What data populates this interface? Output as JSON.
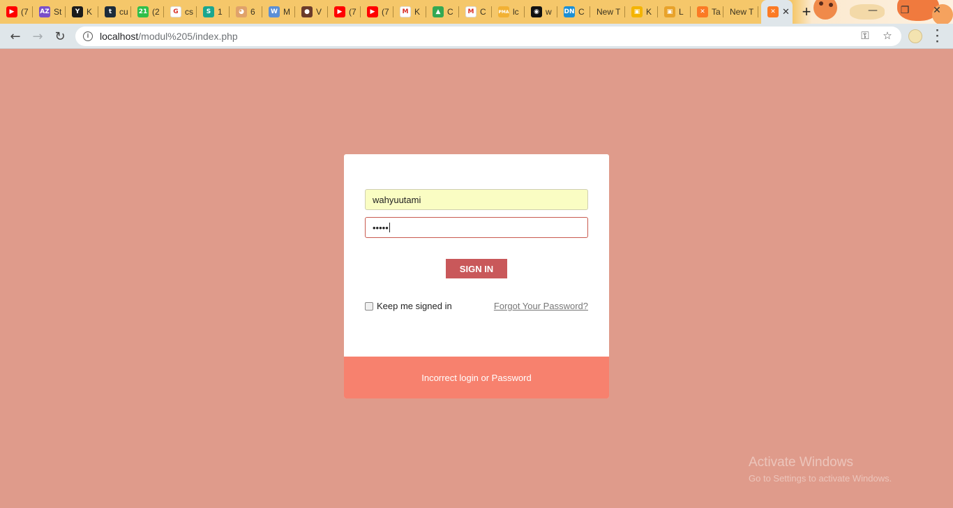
{
  "browser": {
    "tabs": [
      {
        "icon": "youtube-icon",
        "title": "(7",
        "color": "#ff0000",
        "glyph": "▶"
      },
      {
        "icon": "az-icon",
        "title": "St",
        "color": "#7a4fc9",
        "glyph": "AZ"
      },
      {
        "icon": "y-icon",
        "title": "K",
        "color": "#1b1b1b",
        "glyph": "Y"
      },
      {
        "icon": "tumblr-icon",
        "title": "cu",
        "color": "#1d2b3a",
        "glyph": "t"
      },
      {
        "icon": "badge-21-icon",
        "title": "(2",
        "color": "#2fbf4a",
        "glyph": "21"
      },
      {
        "icon": "google-icon",
        "title": "cs",
        "color": "#ffffff",
        "glyph": "G"
      },
      {
        "icon": "s-icon",
        "title": "1",
        "color": "#1aa68f",
        "glyph": "S"
      },
      {
        "icon": "cartoon-icon",
        "title": "6",
        "color": "#e0a26a",
        "glyph": "◕"
      },
      {
        "icon": "wordpress-icon",
        "title": "M",
        "color": "#5b8fd6",
        "glyph": "W"
      },
      {
        "icon": "avatar-photo-icon",
        "title": "V",
        "color": "#6b3b2a",
        "glyph": "●"
      },
      {
        "icon": "youtube-icon",
        "title": "(7",
        "color": "#ff0000",
        "glyph": "▶"
      },
      {
        "icon": "youtube-icon",
        "title": "(7",
        "color": "#ff0000",
        "glyph": "▶"
      },
      {
        "icon": "gmail-icon",
        "title": "K",
        "color": "#ffffff",
        "glyph": "M"
      },
      {
        "icon": "drive-icon",
        "title": "C",
        "color": "#34a853",
        "glyph": "▲"
      },
      {
        "icon": "gmail-icon",
        "title": "C",
        "color": "#ffffff",
        "glyph": "M"
      },
      {
        "icon": "phpmyadmin-icon",
        "title": "lc",
        "color": "#f2b134",
        "glyph": "PMA"
      },
      {
        "icon": "github-icon",
        "title": "w",
        "color": "#111111",
        "glyph": "◉"
      },
      {
        "icon": "dn-icon",
        "title": "C",
        "color": "#1a8fd6",
        "glyph": "DN"
      },
      {
        "icon": "",
        "title": "New T",
        "color": "",
        "glyph": ""
      },
      {
        "icon": "classroom-icon",
        "title": "K",
        "color": "#f4b400",
        "glyph": "▣"
      },
      {
        "icon": "contact-icon",
        "title": "L",
        "color": "#e8a22a",
        "glyph": "▣"
      },
      {
        "icon": "xampp-icon",
        "title": "Ta",
        "color": "#fb7a24",
        "glyph": "✕"
      },
      {
        "icon": "",
        "title": "New T",
        "color": "",
        "glyph": ""
      }
    ],
    "active_tab": {
      "icon": "xampp-icon",
      "color": "#fb7a24",
      "glyph": "✕",
      "close": "✕"
    },
    "new_tab_glyph": "+",
    "window_controls": {
      "minimize": "—",
      "maximize": "❐",
      "close": "✕"
    },
    "url_host": "localhost",
    "url_path": "/modul%205/index.php"
  },
  "login": {
    "username_value": "wahyuutami",
    "password_value": "•••••",
    "signin_label": "SIGN IN",
    "keep_signed_in_label": "Keep me signed in",
    "forgot_label": "Forgot Your Password?",
    "error_message": "Incorrect login or Password"
  },
  "watermark": {
    "title": "Activate Windows",
    "subtitle": "Go to Settings to activate Windows."
  },
  "colors": {
    "page_background": "#df9b8b",
    "signin_button": "#c9585a",
    "error_bar": "#f7816e",
    "username_autofill": "#fafdc3"
  }
}
